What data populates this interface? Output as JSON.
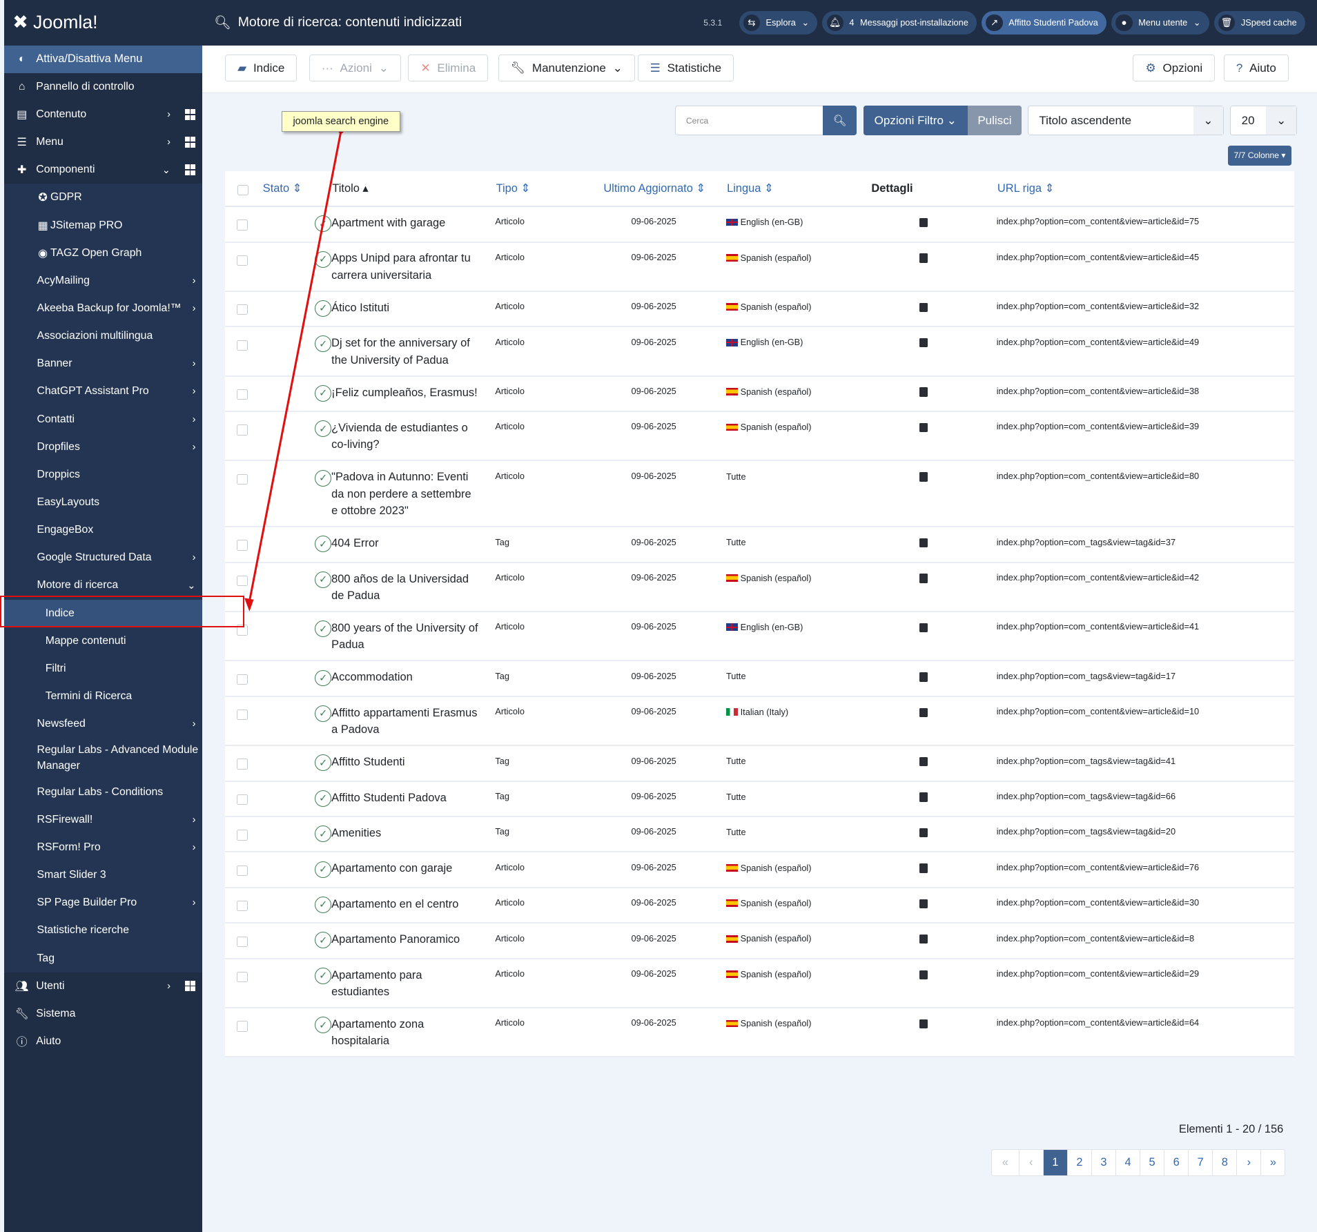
{
  "brand": "Joomla!",
  "header": {
    "title": "Motore di ricerca: contenuti indicizzati",
    "version": "5.3.1",
    "buttons": [
      {
        "label": "Esplora",
        "icon": "compass-icon"
      },
      {
        "label": "Messaggi post-installazione",
        "count": "4",
        "icon": "bell-icon"
      },
      {
        "label": "Affitto Studenti Padova",
        "icon": "external-link-icon"
      },
      {
        "label": "Menu utente",
        "icon": "user-icon"
      },
      {
        "label": "JSpeed cache",
        "icon": "trash-icon"
      }
    ]
  },
  "toolbar": {
    "indice": "Indice",
    "azioni": "Azioni",
    "elimina": "Elimina",
    "manutenzione": "Manutenzione",
    "statistiche": "Statistiche",
    "opzioni": "Opzioni",
    "aiuto": "Aiuto"
  },
  "sidebar": {
    "toggle": "Attiva/Disattiva Menu",
    "items": [
      {
        "label": "Pannello di controllo",
        "icon": "home-icon",
        "lvl": 0
      },
      {
        "label": "Contenuto",
        "icon": "file-icon",
        "lvl": 0,
        "chev": ">",
        "grid": true
      },
      {
        "label": "Menu",
        "icon": "list-icon",
        "lvl": 0,
        "chev": ">",
        "grid": true
      },
      {
        "label": "Componenti",
        "icon": "puzzle-icon",
        "lvl": 0,
        "chev": "v",
        "grid": true
      },
      {
        "label": "GDPR",
        "icon": "eu-icon",
        "lvl": 1
      },
      {
        "label": "JSitemap PRO",
        "icon": "sitemap-icon",
        "lvl": 1
      },
      {
        "label": "TAGZ Open Graph",
        "icon": "tagz-icon",
        "lvl": 1
      },
      {
        "label": "AcyMailing",
        "lvl": 1,
        "chev": ">"
      },
      {
        "label": "Akeeba Backup for Joomla!™",
        "lvl": 1,
        "chev": ">"
      },
      {
        "label": "Associazioni multilingua",
        "lvl": 1
      },
      {
        "label": "Banner",
        "lvl": 1,
        "chev": ">"
      },
      {
        "label": "ChatGPT Assistant Pro",
        "lvl": 1,
        "chev": ">"
      },
      {
        "label": "Contatti",
        "lvl": 1,
        "chev": ">"
      },
      {
        "label": "Dropfiles",
        "lvl": 1,
        "chev": ">"
      },
      {
        "label": "Droppics",
        "lvl": 1
      },
      {
        "label": "EasyLayouts",
        "lvl": 1
      },
      {
        "label": "EngageBox",
        "lvl": 1
      },
      {
        "label": "Google Structured Data",
        "lvl": 1,
        "chev": ">"
      },
      {
        "label": "Motore di ricerca",
        "lvl": 1,
        "chev": "v"
      },
      {
        "label": "Indice",
        "lvl": 2,
        "active": true
      },
      {
        "label": "Mappe contenuti",
        "lvl": 2
      },
      {
        "label": "Filtri",
        "lvl": 2
      },
      {
        "label": "Termini di Ricerca",
        "lvl": 2
      },
      {
        "label": "Newsfeed",
        "lvl": 1,
        "chev": ">"
      },
      {
        "label": "Regular Labs - Advanced Module Manager",
        "lvl": 1,
        "wrap": true
      },
      {
        "label": "Regular Labs - Conditions",
        "lvl": 1
      },
      {
        "label": "RSFirewall!",
        "lvl": 1,
        "chev": ">"
      },
      {
        "label": "RSForm! Pro",
        "lvl": 1,
        "chev": ">"
      },
      {
        "label": "Smart Slider 3",
        "lvl": 1
      },
      {
        "label": "SP Page Builder Pro",
        "lvl": 1,
        "chev": ">"
      },
      {
        "label": "Statistiche ricerche",
        "lvl": 1
      },
      {
        "label": "Tag",
        "lvl": 1
      },
      {
        "label": "Utenti",
        "icon": "users-icon",
        "lvl": 0,
        "chev": ">",
        "grid": true
      },
      {
        "label": "Sistema",
        "icon": "wrench-icon",
        "lvl": 0
      },
      {
        "label": "Aiuto",
        "icon": "info-icon",
        "lvl": 0
      }
    ]
  },
  "filters": {
    "search_placeholder": "Cerca",
    "filter_options": "Opzioni Filtro",
    "clear": "Pulisci",
    "ordering": "Titolo ascendente",
    "limit": "20",
    "columns": "7/7 Colonne"
  },
  "table": {
    "headers": {
      "stato": "Stato",
      "titolo": "Titolo",
      "tipo": "Tipo",
      "aggiornato": "Ultimo Aggiornato",
      "lingua": "Lingua",
      "dettagli": "Dettagli",
      "url": "URL riga"
    },
    "rows": [
      {
        "title": "Apartment with garage",
        "type": "Articolo",
        "date": "09-06-2025",
        "lang": "English (en-GB)",
        "flag": "en",
        "url": "index.php?option=com_content&view=article&id=75"
      },
      {
        "title": "Apps Unipd para afrontar tu carrera universitaria",
        "type": "Articolo",
        "date": "09-06-2025",
        "lang": "Spanish (español)",
        "flag": "es",
        "url": "index.php?option=com_content&view=article&id=45"
      },
      {
        "title": "Ático Istituti",
        "type": "Articolo",
        "date": "09-06-2025",
        "lang": "Spanish (español)",
        "flag": "es",
        "url": "index.php?option=com_content&view=article&id=32"
      },
      {
        "title": "Dj set for the anniversary of the University of Padua",
        "type": "Articolo",
        "date": "09-06-2025",
        "lang": "English (en-GB)",
        "flag": "en",
        "url": "index.php?option=com_content&view=article&id=49"
      },
      {
        "title": "¡Feliz cumpleaños, Erasmus!",
        "type": "Articolo",
        "date": "09-06-2025",
        "lang": "Spanish (español)",
        "flag": "es",
        "url": "index.php?option=com_content&view=article&id=38"
      },
      {
        "title": "¿Vivienda de estudiantes o co-living?",
        "type": "Articolo",
        "date": "09-06-2025",
        "lang": "Spanish (español)",
        "flag": "es",
        "url": "index.php?option=com_content&view=article&id=39"
      },
      {
        "title": "\"Padova in Autunno: Eventi da non perdere a settembre e ottobre 2023\"",
        "type": "Articolo",
        "date": "09-06-2025",
        "lang": "Tutte",
        "flag": "",
        "url": "index.php?option=com_content&view=article&id=80"
      },
      {
        "title": "404 Error",
        "type": "Tag",
        "date": "09-06-2025",
        "lang": "Tutte",
        "flag": "",
        "url": "index.php?option=com_tags&view=tag&id=37"
      },
      {
        "title": "800 años de la Universidad de Padua",
        "type": "Articolo",
        "date": "09-06-2025",
        "lang": "Spanish (español)",
        "flag": "es",
        "url": "index.php?option=com_content&view=article&id=42"
      },
      {
        "title": "800 years of the University of Padua",
        "type": "Articolo",
        "date": "09-06-2025",
        "lang": "English (en-GB)",
        "flag": "en",
        "url": "index.php?option=com_content&view=article&id=41"
      },
      {
        "title": "Accommodation",
        "type": "Tag",
        "date": "09-06-2025",
        "lang": "Tutte",
        "flag": "",
        "url": "index.php?option=com_tags&view=tag&id=17"
      },
      {
        "title": "Affitto appartamenti Erasmus a Padova",
        "type": "Articolo",
        "date": "09-06-2025",
        "lang": "Italian (Italy)",
        "flag": "it",
        "url": "index.php?option=com_content&view=article&id=10"
      },
      {
        "title": "Affitto Studenti",
        "type": "Tag",
        "date": "09-06-2025",
        "lang": "Tutte",
        "flag": "",
        "url": "index.php?option=com_tags&view=tag&id=41"
      },
      {
        "title": "Affitto Studenti Padova",
        "type": "Tag",
        "date": "09-06-2025",
        "lang": "Tutte",
        "flag": "",
        "url": "index.php?option=com_tags&view=tag&id=66"
      },
      {
        "title": "Amenities",
        "type": "Tag",
        "date": "09-06-2025",
        "lang": "Tutte",
        "flag": "",
        "url": "index.php?option=com_tags&view=tag&id=20"
      },
      {
        "title": "Apartamento con garaje",
        "type": "Articolo",
        "date": "09-06-2025",
        "lang": "Spanish (español)",
        "flag": "es",
        "url": "index.php?option=com_content&view=article&id=76"
      },
      {
        "title": "Apartamento en el centro",
        "type": "Articolo",
        "date": "09-06-2025",
        "lang": "Spanish (español)",
        "flag": "es",
        "url": "index.php?option=com_content&view=article&id=30"
      },
      {
        "title": "Apartamento Panoramico",
        "type": "Articolo",
        "date": "09-06-2025",
        "lang": "Spanish (español)",
        "flag": "es",
        "url": "index.php?option=com_content&view=article&id=8"
      },
      {
        "title": "Apartamento para estudiantes",
        "type": "Articolo",
        "date": "09-06-2025",
        "lang": "Spanish (español)",
        "flag": "es",
        "url": "index.php?option=com_content&view=article&id=29"
      },
      {
        "title": "Apartamento zona hospitalaria",
        "type": "Articolo",
        "date": "09-06-2025",
        "lang": "Spanish (español)",
        "flag": "es",
        "url": "index.php?option=com_content&view=article&id=64"
      }
    ]
  },
  "count": "Elementi 1 - 20 / 156",
  "pagination": {
    "first": "«",
    "prev": "‹",
    "pages": [
      "1",
      "2",
      "3",
      "4",
      "5",
      "6",
      "7",
      "8"
    ],
    "current": "1",
    "next": "›",
    "last": "»"
  },
  "annotation": {
    "tooltip": "joomla search engine",
    "color": "#e01010"
  }
}
